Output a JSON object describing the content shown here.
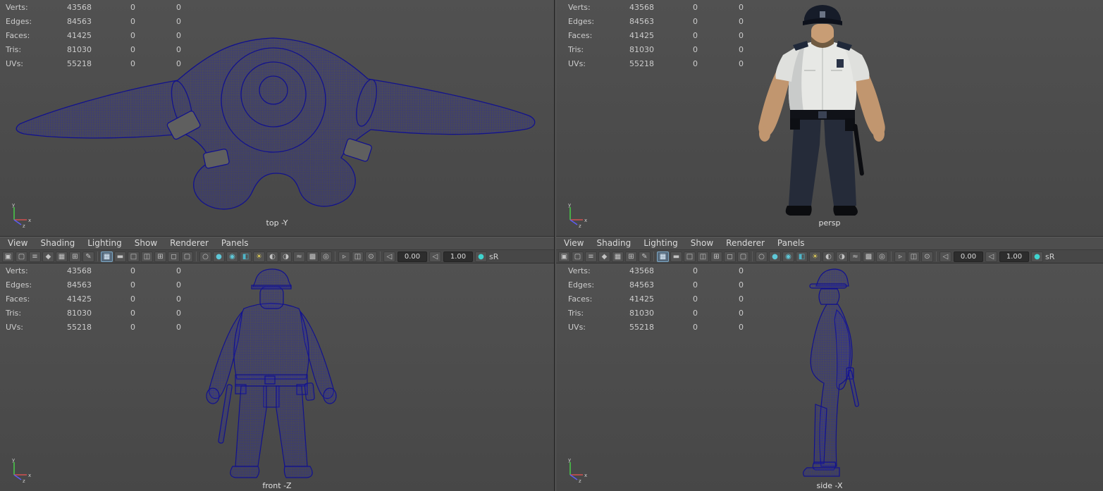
{
  "colors": {
    "viewport_background": "#4c4c4c",
    "wireframe_blue": "#1c1ca0",
    "menubar_background": "#4e4e4e",
    "toolbar_background": "#474747",
    "hud_text": "#cccccc",
    "active_icon_highlight": "#7ba7c4",
    "axis_x_red": "#d24f4f",
    "axis_y_green": "#49c549",
    "axis_z_blue": "#5d5df0"
  },
  "hud": {
    "rows": [
      {
        "label": "Verts:",
        "total": "43568",
        "col2": "0",
        "col3": "0"
      },
      {
        "label": "Edges:",
        "total": "84563",
        "col2": "0",
        "col3": "0"
      },
      {
        "label": "Faces:",
        "total": "41425",
        "col2": "0",
        "col3": "0"
      },
      {
        "label": "Tris:",
        "total": "81030",
        "col2": "0",
        "col3": "0"
      },
      {
        "label": "UVs:",
        "total": "55218",
        "col2": "0",
        "col3": "0"
      }
    ]
  },
  "menu": {
    "items": [
      "View",
      "Shading",
      "Lighting",
      "Show",
      "Renderer",
      "Panels"
    ]
  },
  "toolbar": {
    "items": [
      {
        "type": "icon",
        "name": "select-camera-icon",
        "glyph": "▣"
      },
      {
        "type": "icon",
        "name": "lock-camera-icon",
        "glyph": "▢"
      },
      {
        "type": "icon",
        "name": "camera-attributes-icon",
        "glyph": "≡"
      },
      {
        "type": "icon",
        "name": "bookmarks-icon",
        "glyph": "◆"
      },
      {
        "type": "icon",
        "name": "image-plane-icon",
        "glyph": "▦"
      },
      {
        "type": "icon",
        "name": "2d-pan-zoom-icon",
        "glyph": "⊞"
      },
      {
        "type": "icon",
        "name": "grease-pencil-icon",
        "glyph": "✎"
      },
      {
        "type": "sep"
      },
      {
        "type": "icon",
        "name": "grid-icon",
        "glyph": "▦",
        "active": true
      },
      {
        "type": "icon",
        "name": "film-gate-icon",
        "glyph": "▬"
      },
      {
        "type": "icon",
        "name": "resolution-gate-icon",
        "glyph": "□"
      },
      {
        "type": "icon",
        "name": "gate-mask-icon",
        "glyph": "◫"
      },
      {
        "type": "icon",
        "name": "field-chart-icon",
        "glyph": "⊞"
      },
      {
        "type": "icon",
        "name": "safe-action-icon",
        "glyph": "◻"
      },
      {
        "type": "icon",
        "name": "safe-title-icon",
        "glyph": "▢"
      },
      {
        "type": "sep"
      },
      {
        "type": "icon",
        "name": "wireframe-icon",
        "glyph": "○"
      },
      {
        "type": "icon",
        "name": "smooth-shade-icon",
        "glyph": "●",
        "color": "#5fc8d8"
      },
      {
        "type": "icon",
        "name": "wireframe-on-shaded-icon",
        "glyph": "◉",
        "color": "#5fc8d8"
      },
      {
        "type": "icon",
        "name": "textured-icon",
        "glyph": "◧",
        "color": "#4fb6c9"
      },
      {
        "type": "icon",
        "name": "use-all-lights-icon",
        "glyph": "☀",
        "color": "#e3cf57"
      },
      {
        "type": "icon",
        "name": "shadows-icon",
        "glyph": "◐"
      },
      {
        "type": "icon",
        "name": "screen-space-ao-icon",
        "glyph": "◑"
      },
      {
        "type": "icon",
        "name": "motion-blur-icon",
        "glyph": "≈"
      },
      {
        "type": "icon",
        "name": "multisample-aa-icon",
        "glyph": "▩"
      },
      {
        "type": "icon",
        "name": "depth-of-field-icon",
        "glyph": "◎"
      },
      {
        "type": "sep"
      },
      {
        "type": "icon",
        "name": "isolate-select-icon",
        "glyph": "▹"
      },
      {
        "type": "icon",
        "name": "x-ray-icon",
        "glyph": "◫"
      },
      {
        "type": "icon",
        "name": "x-ray-joints-icon",
        "glyph": "⊙"
      },
      {
        "type": "sep"
      },
      {
        "type": "icon",
        "name": "exposure-toggle-icon",
        "glyph": "◁"
      },
      {
        "type": "field",
        "name": "exposure-field",
        "value": "0.00"
      },
      {
        "type": "icon",
        "name": "gamma-toggle-icon",
        "glyph": "◁"
      },
      {
        "type": "field",
        "name": "gamma-field",
        "value": "1.00"
      },
      {
        "type": "icon",
        "name": "color-management-icon",
        "glyph": "●",
        "color": "#3fd4cf"
      },
      {
        "type": "label",
        "name": "view-transform-label",
        "text": "sR"
      }
    ]
  },
  "viewports": {
    "top": {
      "label": "top -Y"
    },
    "persp": {
      "label": "persp"
    },
    "front": {
      "label": "front -Z"
    },
    "side": {
      "label": "side -X"
    }
  },
  "axis_gizmo": {
    "x": "x",
    "y": "y",
    "z": "z"
  }
}
